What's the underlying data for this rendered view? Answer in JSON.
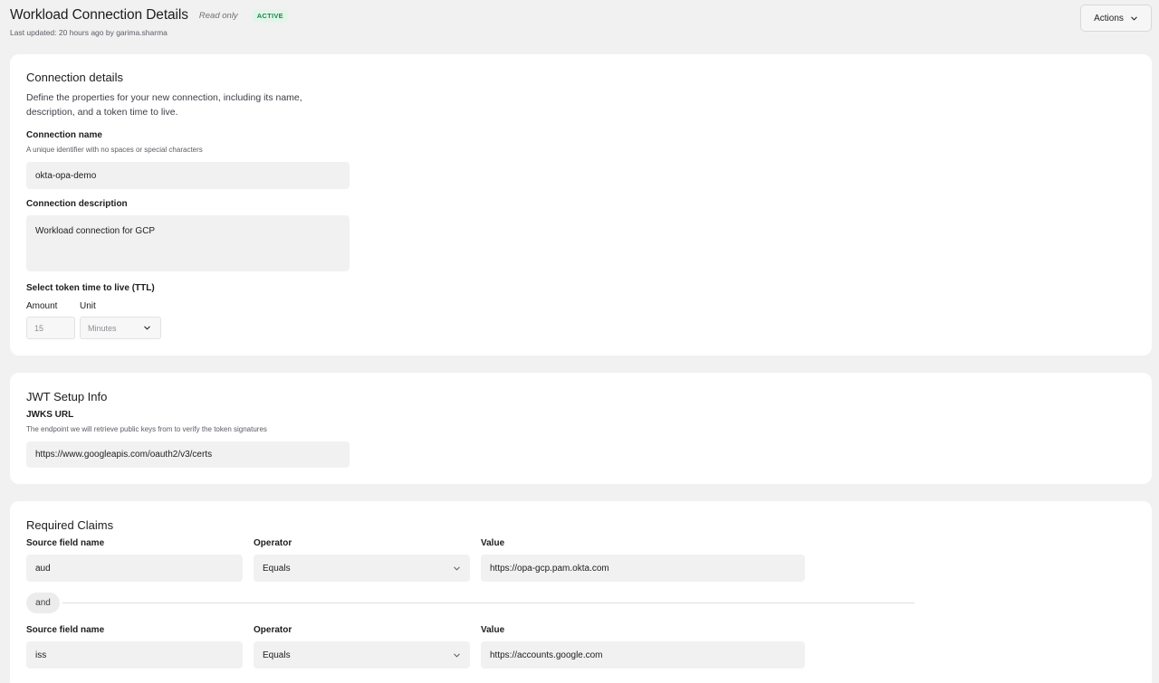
{
  "header": {
    "title": "Workload Connection Details",
    "read_only": "Read only",
    "status_badge": "ACTIVE",
    "last_updated": "Last updated: 20 hours ago by garima.sharma",
    "actions_label": "Actions"
  },
  "connection_details": {
    "title": "Connection details",
    "description_line1": "Define the properties for your new connection, including its name,",
    "description_line2": "description, and a token time to live.",
    "name_label": "Connection name",
    "name_hint": "A unique identifier with no spaces or special characters",
    "name_value": "okta-opa-demo",
    "description_label": "Connection description",
    "description_value": "Workload connection for GCP",
    "ttl_label": "Select token time to live (TTL)",
    "amount_label": "Amount",
    "unit_label": "Unit",
    "amount_value": "15",
    "unit_value": "Minutes"
  },
  "jwt_setup": {
    "title": "JWT Setup Info",
    "jwks_label": "JWKS URL",
    "jwks_hint": "The endpoint we will retrieve public keys from to verify the token signatures",
    "jwks_value": "https://www.googleapis.com/oauth2/v3/certs"
  },
  "required_claims": {
    "title": "Required Claims",
    "source_label": "Source field name",
    "operator_label": "Operator",
    "value_label": "Value",
    "connector": "and",
    "claims": [
      {
        "source": "aud",
        "operator": "Equals",
        "value": "https://opa-gcp.pam.okta.com"
      },
      {
        "source": "iss",
        "operator": "Equals",
        "value": "https://accounts.google.com"
      }
    ]
  },
  "icons": {
    "actions_chevron": "chevron-down-icon",
    "select_chevron": "chevron-down-icon"
  }
}
